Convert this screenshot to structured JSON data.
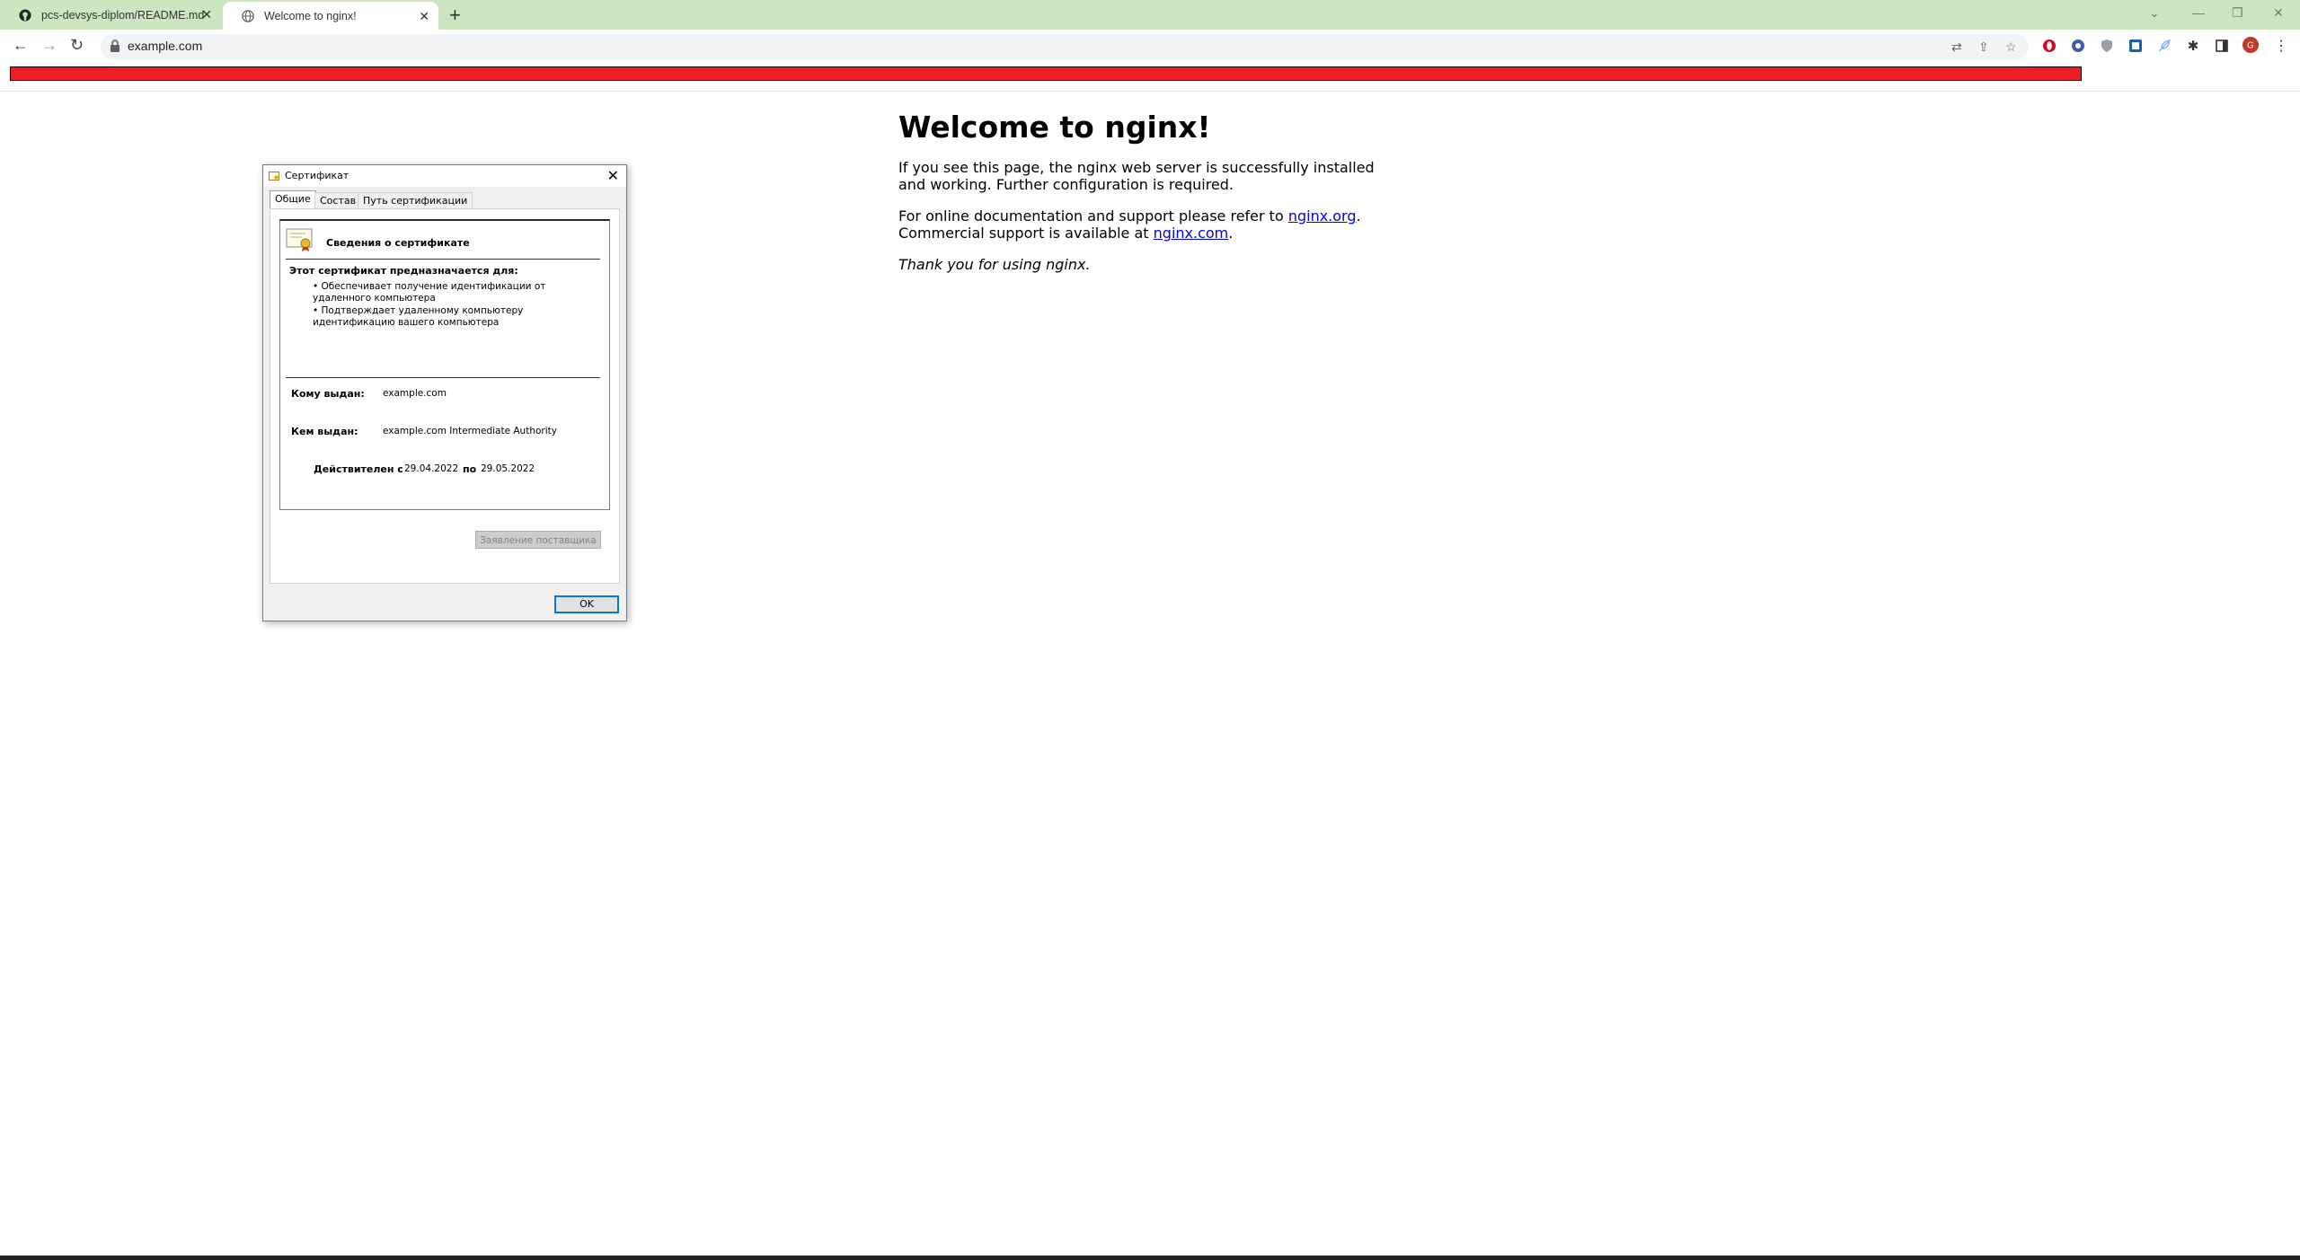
{
  "browser": {
    "tabs": [
      {
        "title": "pcs-devsys-diplom/README.md at main",
        "favicon": "github-icon",
        "active": false
      },
      {
        "title": "Welcome to nginx!",
        "favicon": "globe-icon",
        "active": true
      }
    ],
    "new_tab_label": "+",
    "url": "example.com",
    "window_controls": {
      "minimize": "—",
      "restore": "❐",
      "close": "✕"
    }
  },
  "page": {
    "heading": "Welcome to nginx!",
    "para1": "If you see this page, the nginx web server is successfully installed and working. Further configuration is required.",
    "para2_prefix": "For online documentation and support please refer to ",
    "link_org": "nginx.org",
    "para2_mid": ". Commercial support is available at ",
    "link_com": "nginx.com",
    "para2_suffix": ".",
    "thanks": "Thank you for using nginx.",
    "red_bar_color": "#ee1c25"
  },
  "dialog": {
    "title": "Сертификат",
    "tabs": [
      "Общие",
      "Состав",
      "Путь сертификации"
    ],
    "header": "Сведения о сертификате",
    "purpose_title": "Этот сертификат предназначается для:",
    "purposes": [
      "Обеспечивает получение идентификации от удаленного компьютера",
      "Подтверждает удаленному компьютеру идентификацию вашего компьютера"
    ],
    "issued_to_label": "Кому выдан:",
    "issued_to": "example.com",
    "issued_by_label": "Кем выдан:",
    "issued_by": "example.com Intermediate Authority",
    "valid_from_label": "Действителен с",
    "valid_from": "29.04.2022",
    "valid_to_label": "по",
    "valid_to": "29.05.2022",
    "issuer_statement_button": "Заявление поставщика",
    "ok_button": "OK"
  }
}
